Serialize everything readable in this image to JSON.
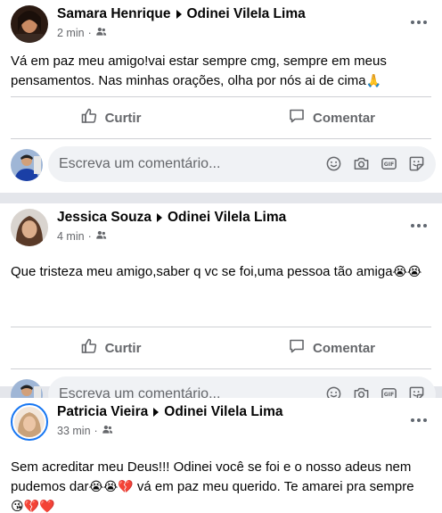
{
  "posts": [
    {
      "author": "Samara Henrique",
      "target": "Odinei Vilela Lima",
      "time": "2 min",
      "dot": "·",
      "text_lines": [
        "Vá em paz meu amigo!vai estar sempre cmg, sempre em meus",
        "pensamentos. Nas minhas orações, olha por nós ai de cima"
      ],
      "text_emoji": "🙏",
      "like_label": "Curtir",
      "comment_label": "Comentar",
      "comment_placeholder": "Escreva um comentário..."
    },
    {
      "author": "Jessica Souza",
      "target": "Odinei Vilela Lima",
      "time": "4 min",
      "dot": "·",
      "text_lines": [
        "Que tristeza meu amigo,saber q vc se foi,uma pessoa tão amiga"
      ],
      "text_emoji": "😭😭",
      "like_label": "Curtir",
      "comment_label": "Comentar",
      "comment_placeholder": "Escreva um comentário..."
    },
    {
      "author": "Patricia Vieira",
      "target": "Odinei Vilela Lima",
      "time": "33 min",
      "dot": "·",
      "text_line1": "Sem acreditar meu Deus!!! Odinei você se foi e o nosso adeus nem",
      "text_line2_a": "pudemos dar",
      "text_line2_emoji": "😭😭💔",
      "text_line2_b": " vá em paz meu querido. Te amarei pra sempre",
      "text_line3_emoji": "😘💔❤️"
    }
  ],
  "colors": {
    "accent": "#1877f2",
    "secondary_text": "#65676b",
    "background": "#e4e6eb",
    "input_bg": "#f0f2f5"
  },
  "icons": {
    "audience": "friends-icon",
    "like": "thumbs-up-icon",
    "comment": "speech-bubble-icon",
    "more": "more-options-icon",
    "composer": [
      "smiley-icon",
      "camera-icon",
      "gif-icon",
      "sticker-icon"
    ]
  }
}
